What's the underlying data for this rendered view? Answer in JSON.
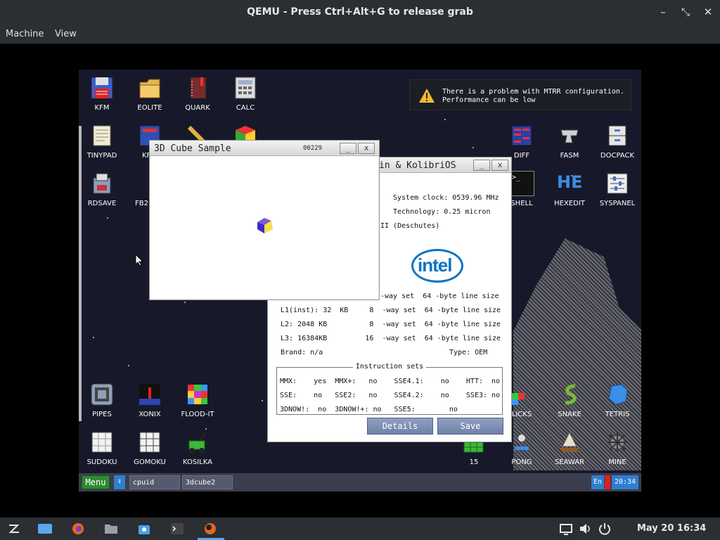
{
  "host": {
    "title": "QEMU - Press Ctrl+Alt+G to release grab",
    "menus": [
      "Machine",
      "View"
    ],
    "controls": {
      "minimize": "–",
      "restore": "⤡",
      "close": "✕"
    }
  },
  "notification": {
    "line1": "There is a problem with MTRR configuration.",
    "line2": "Performance can be low",
    "icon": "warning-icon"
  },
  "desktop_icons": {
    "kfm": "KFM",
    "eolite": "EOLITE",
    "quark": "QUARK",
    "calc": "CALC",
    "tinypad": "TINYPAD",
    "kf": "KF",
    "rdsave": "RDSAVE",
    "fb2": "FB2",
    "diff": "DIFF",
    "fasm": "FASM",
    "docpack": "DOCPACK",
    "shell": "SHELL",
    "hexedit": "HEXEDIT",
    "syspanel": "SYSPANEL",
    "pipes": "PIPES",
    "xonix": "XONIX",
    "floodit": "FLOOD-IT",
    "licks": "LICKS",
    "snake": "SNAKE",
    "tetris": "TETRIS",
    "sudoku": "SUDOKU",
    "gomoku": "GOMOKU",
    "kosilka": "KOSILKA",
    "fifteen": "15",
    "pong": "PONG",
    "seawar": "SEAWAR",
    "mine": "MINE",
    "hex_text": "HE",
    "shell_prompt": ">_"
  },
  "cube_window": {
    "title": "3D Cube Sample",
    "counter": "00229",
    "minimize": "_",
    "close": "x"
  },
  "cpuid_window": {
    "title_visible": "in & KolibriOS",
    "minimize": "_",
    "close": "x",
    "clock": "System clock: 0539.96 MHz",
    "technology": "Technology: 0.25 micron",
    "family": "II (Deschutes)",
    "logo": "intel",
    "l1_partial": "-way set  64 -byte line size",
    "l1_inst": "L1(inst): 32  KB     8  -way set  64 -byte line size",
    "l2": "L2: 2048 KB          8  -way set  64 -byte line size",
    "l3": "L3: 16384KB         16  -way set  64 -byte line size",
    "brand": "Brand: n/a",
    "type": "Type: OEM",
    "instruction_sets_label": "Instruction sets",
    "row1": "MMX:    yes  MMX+:   no    SSE4.1:    no    HTT:  no",
    "row2": "SSE:    no   SSE2:   no    SSE4.2:    no    SSE3: no",
    "row3": "3DNOW!:  no  3DNOW!+: no   SSE5:        no",
    "details_button": "Details",
    "save_button": "Save"
  },
  "guest_taskbar": {
    "menu": "Menu",
    "scroll": "⇕",
    "tasks": [
      "cpuid",
      "3dcube2"
    ],
    "lang": "En",
    "time": "20:34"
  },
  "host_panel": {
    "clock": "May 20  16:34"
  },
  "colors": {
    "desktop": "#17192a",
    "accent_blue": "#2f7fd0",
    "menu_green": "#2f8a2f",
    "intel_blue": "#0a73c4"
  }
}
